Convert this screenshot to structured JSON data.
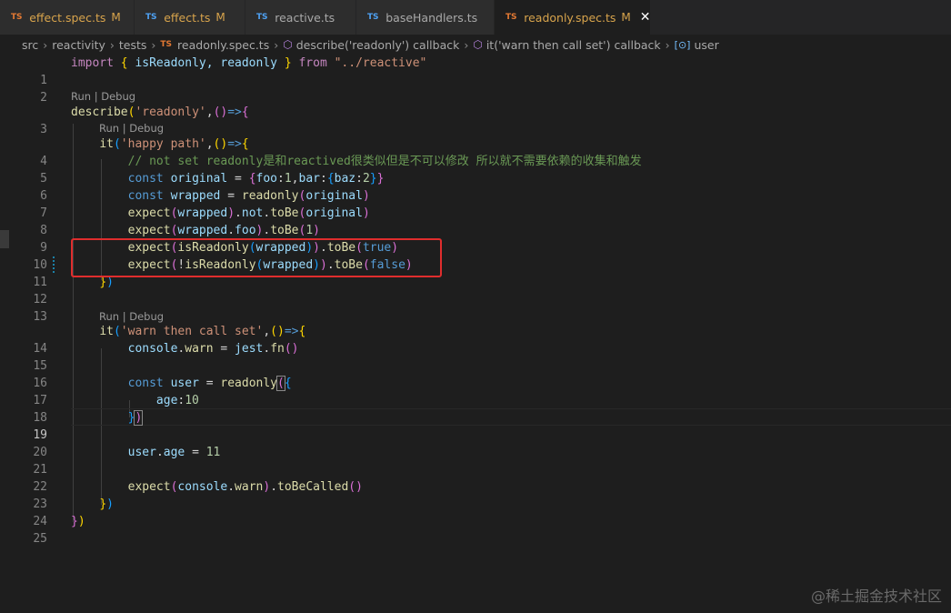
{
  "tabs": [
    {
      "label": "effect.spec.ts",
      "icon": "TS",
      "status": "M",
      "active": false
    },
    {
      "label": "effect.ts",
      "icon": "TS",
      "status": "M",
      "active": false
    },
    {
      "label": "reactive.ts",
      "icon": "TS",
      "status": "",
      "active": false
    },
    {
      "label": "baseHandlers.ts",
      "icon": "TS",
      "status": "",
      "active": false
    },
    {
      "label": "readonly.spec.ts",
      "icon": "TS",
      "status": "M",
      "active": true
    }
  ],
  "close_glyph": "✕",
  "breadcrumb": {
    "src": "src",
    "reactivity": "reactivity",
    "tests": "tests",
    "file_icon": "TS",
    "file": "readonly.spec.ts",
    "describe": "describe('readonly') callback",
    "it": "it('warn then call set') callback",
    "symbol": "user"
  },
  "codelens": {
    "run": "Run",
    "sep": " | ",
    "debug": "Debug"
  },
  "line_numbers": [
    "1",
    "2",
    "3",
    "4",
    "5",
    "6",
    "7",
    "8",
    "9",
    "10",
    "11",
    "12",
    "13",
    "14",
    "15",
    "16",
    "17",
    "18",
    "19",
    "20",
    "21",
    "22",
    "23",
    "24",
    "25"
  ],
  "code": {
    "l1": {
      "import": "import",
      "open": "{",
      "names": " isReadonly, readonly ",
      "close": "}",
      "from": "from",
      "path": "\"../reactive\""
    },
    "l3": {
      "describe": "describe",
      "name": "'readonly'",
      "arrow": "=>"
    },
    "l4": {
      "it": "it",
      "name": "'happy path'",
      "arrow": "=>"
    },
    "l5": {
      "comment": "// not set readonly是和reactived很类似但是不可以修改 所以就不需要依赖的收集和触发"
    },
    "l6": {
      "const": "const",
      "name": "original",
      "eq": " = ",
      "foo": "foo",
      "one": "1",
      "bar": "bar",
      "baz": "baz",
      "two": "2"
    },
    "l7": {
      "const": "const",
      "name": "wrapped",
      "eq": " = ",
      "fn": "readonly",
      "arg": "original"
    },
    "l8": {
      "expect": "expect",
      "arg": "wrapped",
      "not": "not",
      "toBe": "toBe",
      "val": "original"
    },
    "l9": {
      "expect": "expect",
      "arg": "wrapped",
      "prop": "foo",
      "toBe": "toBe",
      "val": "1"
    },
    "l10": {
      "expect": "expect",
      "fn": "isReadonly",
      "arg": "wrapped",
      "toBe": "toBe",
      "val": "true"
    },
    "l11": {
      "expect": "expect",
      "bang": "!",
      "fn": "isReadonly",
      "arg": "wrapped",
      "toBe": "toBe",
      "val": "false"
    },
    "l14": {
      "it": "it",
      "name": "'warn then call set'",
      "arrow": "=>"
    },
    "l15": {
      "console": "console",
      "warn": "warn",
      "eq": " = ",
      "jest": "jest",
      "fn": "fn"
    },
    "l17": {
      "const": "const",
      "name": "user",
      "eq": " = ",
      "fn": "readonly"
    },
    "l18": {
      "key": "age",
      "val": "10"
    },
    "l21": {
      "obj": "user",
      "prop": "age",
      "eq": " = ",
      "val": "11"
    },
    "l23": {
      "expect": "expect",
      "console": "console",
      "warn": "warn",
      "called": "toBeCalled"
    }
  },
  "watermark": "@稀土掘金技术社区",
  "colors": {
    "highlight_box": "#e02d2d",
    "background": "#1e1e1e",
    "tab_bar": "#252526"
  }
}
